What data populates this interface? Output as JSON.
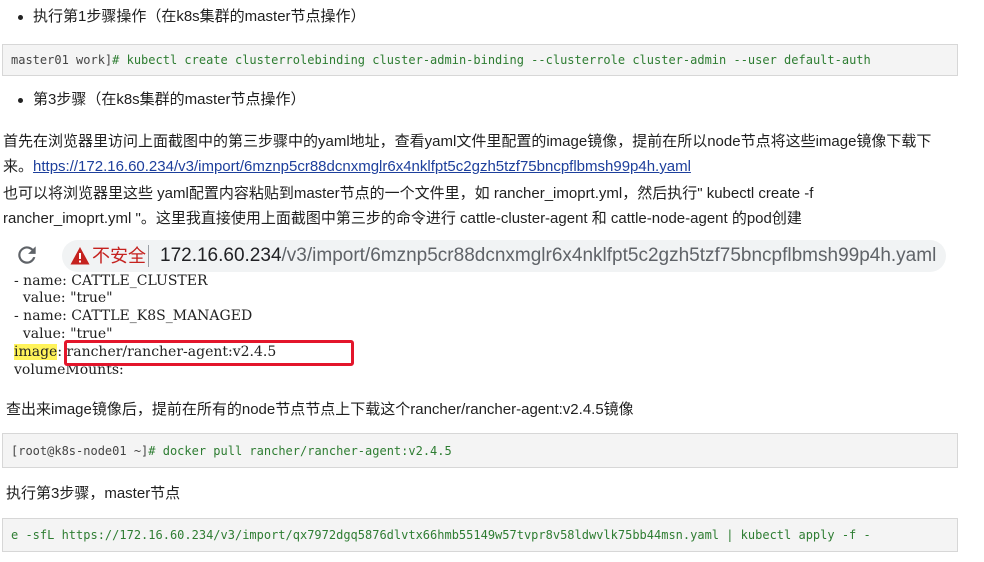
{
  "bullets": {
    "step1": "执行第1步骤操作（在k8s集群的master节点操作）",
    "step3": "第3步骤（在k8s集群的master节点操作）"
  },
  "code1": {
    "prompt": "master01 work]",
    "command": "# kubectl create clusterrolebinding cluster-admin-binding --clusterrole cluster-admin --user default-auth"
  },
  "paragraph": {
    "line1": "首先在浏览器里访问上面截图中的第三步骤中的yaml地址，查看yaml文件里配置的image镜像，提前在所以node节点将这些image镜像下载下",
    "line2_prefix": "来。",
    "link": "https://172.16.60.234/v3/import/6mznp5cr88dcnxmglr6x4nklfpt5c2gzh5tzf75bncpflbmsh99p4h.yaml",
    "line3": "也可以将浏览器里这些 yaml配置内容粘贴到master节点的一个文件里，如 rancher_imoprt.yml，然后执行\" kubectl create -f",
    "line4": "rancher_imoprt.yml \"。这里我直接使用上面截图中第三步的命令进行 cattle-cluster-agent 和 cattle-node-agent 的pod创建"
  },
  "browser": {
    "security_label": "不安全",
    "url_host": "172.16.60.234",
    "url_path": "/v3/import/6mznp5cr88dcnxmglr6x4nklfpt5c2gzh5tzf75bncpflbmsh99p4h.yaml",
    "yaml_lines": [
      "- name: CATTLE_CLUSTER",
      "  value: \"true\"",
      "- name: CATTLE_K8S_MANAGED",
      "  value: \"true\""
    ],
    "image_key": "image",
    "image_value": ": rancher/rancher-agent:v2.4.5",
    "last_line": "volumeMounts:"
  },
  "note1": "查出来image镜像后，提前在所有的node节点节点上下载这个rancher/rancher-agent:v2.4.5镜像",
  "code2": {
    "prompt": "[root@k8s-node01 ~]",
    "command": "# docker pull rancher/rancher-agent:v2.4.5"
  },
  "note2": "执行第3步骤，master节点",
  "code3": {
    "text": "e -sfL https://172.16.60.234/v3/import/qx7972dgq5876dlvtx66hmb55149w57tvpr8v58ldwvlk75bb44msn.yaml | kubectl apply -f -"
  }
}
